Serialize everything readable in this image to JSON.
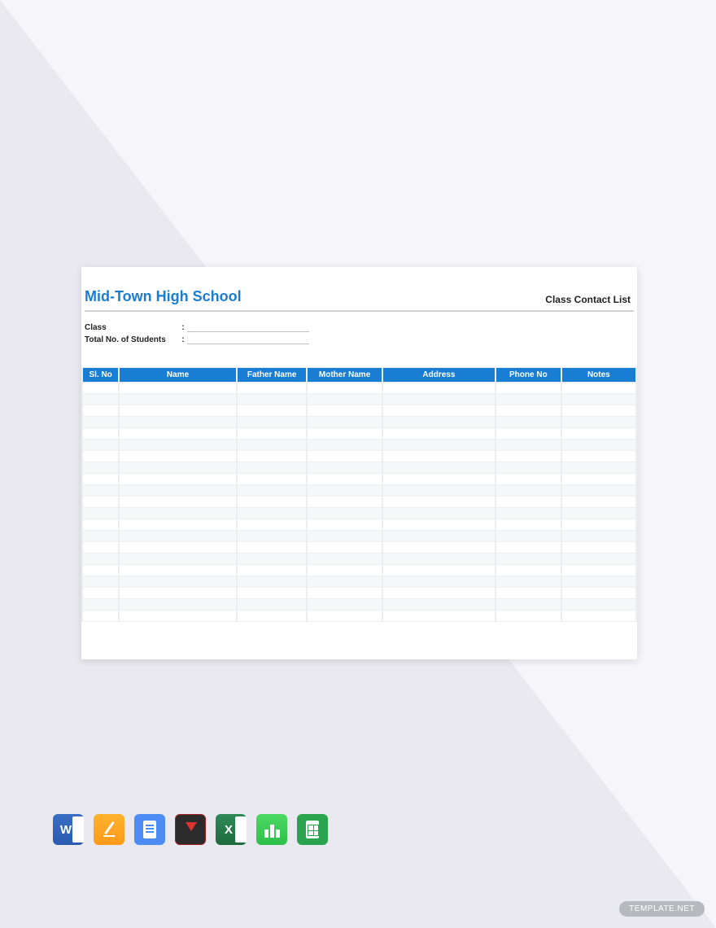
{
  "document": {
    "school_title": "Mid-Town High School",
    "subheader": "Class Contact List",
    "fields": {
      "class_label": "Class",
      "total_label": "Total No. of Students",
      "colon": ":"
    },
    "table": {
      "headers": {
        "slno": "Sl. No",
        "name": "Name",
        "father": "Father Name",
        "mother": "Mother Name",
        "address": "Address",
        "phone": "Phone No",
        "notes": "Notes"
      },
      "row_count": 21
    }
  },
  "icons": {
    "word": "W",
    "excel": "X"
  },
  "watermark": {
    "brand": "TEMPLATE",
    "suffix": ".NET"
  }
}
